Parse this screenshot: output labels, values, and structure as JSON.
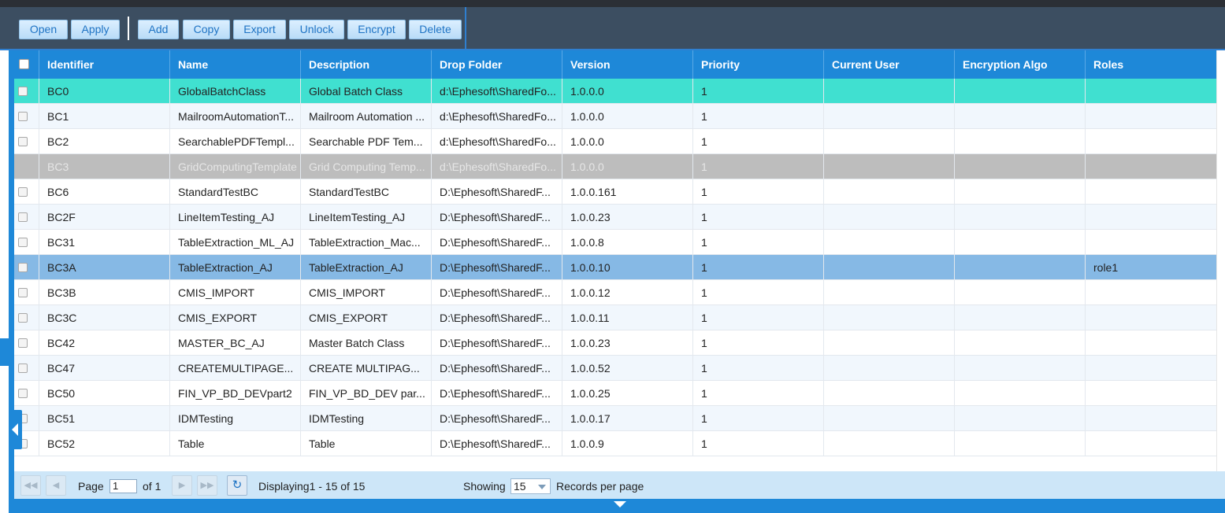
{
  "toolbar": {
    "buttons": [
      {
        "id": "open",
        "label": "Open"
      },
      {
        "id": "apply",
        "label": "Apply"
      },
      {
        "id": "add",
        "label": "Add"
      },
      {
        "id": "copy",
        "label": "Copy"
      },
      {
        "id": "export",
        "label": "Export"
      },
      {
        "id": "unlock",
        "label": "Unlock"
      },
      {
        "id": "encrypt",
        "label": "Encrypt"
      },
      {
        "id": "delete",
        "label": "Delete"
      }
    ]
  },
  "grid": {
    "columns": [
      "Identifier",
      "Name",
      "Description",
      "Drop Folder",
      "Version",
      "Priority",
      "Current User",
      "Encryption Algo",
      "Roles"
    ],
    "rows": [
      {
        "state": "selected-teal",
        "cells": [
          "BC0",
          "GlobalBatchClass",
          "Global Batch Class",
          "d:\\Ephesoft\\SharedFo...",
          "1.0.0.0",
          "1",
          "",
          "",
          ""
        ]
      },
      {
        "state": "alt",
        "cells": [
          "BC1",
          "MailroomAutomationT...",
          "Mailroom Automation ...",
          "d:\\Ephesoft\\SharedFo...",
          "1.0.0.0",
          "1",
          "",
          "",
          ""
        ]
      },
      {
        "state": "plain",
        "cells": [
          "BC2",
          "SearchablePDFTempl...",
          "Searchable PDF Tem...",
          "d:\\Ephesoft\\SharedFo...",
          "1.0.0.0",
          "1",
          "",
          "",
          ""
        ]
      },
      {
        "state": "disabled",
        "cells": [
          "BC3",
          "GridComputingTemplate",
          "Grid Computing Temp...",
          "d:\\Ephesoft\\SharedFo...",
          "1.0.0.0",
          "1",
          "",
          "",
          ""
        ]
      },
      {
        "state": "plain",
        "cells": [
          "BC6",
          "StandardTestBC",
          "StandardTestBC",
          "D:\\Ephesoft\\SharedF...",
          "1.0.0.161",
          "1",
          "",
          "",
          ""
        ]
      },
      {
        "state": "alt",
        "cells": [
          "BC2F",
          "LineItemTesting_AJ",
          "LineItemTesting_AJ",
          "D:\\Ephesoft\\SharedF...",
          "1.0.0.23",
          "1",
          "",
          "",
          ""
        ]
      },
      {
        "state": "plain",
        "cells": [
          "BC31",
          "TableExtraction_ML_AJ",
          "TableExtraction_Mac...",
          "D:\\Ephesoft\\SharedF...",
          "1.0.0.8",
          "1",
          "",
          "",
          ""
        ]
      },
      {
        "state": "selected-blue",
        "cells": [
          "BC3A",
          "TableExtraction_AJ",
          "TableExtraction_AJ",
          "D:\\Ephesoft\\SharedF...",
          "1.0.0.10",
          "1",
          "",
          "",
          "role1"
        ]
      },
      {
        "state": "plain",
        "cells": [
          "BC3B",
          "CMIS_IMPORT",
          "CMIS_IMPORT",
          "D:\\Ephesoft\\SharedF...",
          "1.0.0.12",
          "1",
          "",
          "",
          ""
        ]
      },
      {
        "state": "alt",
        "cells": [
          "BC3C",
          "CMIS_EXPORT",
          "CMIS_EXPORT",
          "D:\\Ephesoft\\SharedF...",
          "1.0.0.11",
          "1",
          "",
          "",
          ""
        ]
      },
      {
        "state": "plain",
        "cells": [
          "BC42",
          "MASTER_BC_AJ",
          "Master Batch Class",
          "D:\\Ephesoft\\SharedF...",
          "1.0.0.23",
          "1",
          "",
          "",
          ""
        ]
      },
      {
        "state": "alt",
        "cells": [
          "BC47",
          "CREATEMULTIPAGE...",
          "CREATE MULTIPAG...",
          "D:\\Ephesoft\\SharedF...",
          "1.0.0.52",
          "1",
          "",
          "",
          ""
        ]
      },
      {
        "state": "plain",
        "cells": [
          "BC50",
          "FIN_VP_BD_DEVpart2",
          "FIN_VP_BD_DEV par...",
          "D:\\Ephesoft\\SharedF...",
          "1.0.0.25",
          "1",
          "",
          "",
          ""
        ]
      },
      {
        "state": "alt",
        "cells": [
          "BC51",
          "IDMTesting",
          "IDMTesting",
          "D:\\Ephesoft\\SharedF...",
          "1.0.0.17",
          "1",
          "",
          "",
          ""
        ]
      },
      {
        "state": "plain",
        "cells": [
          "BC52",
          "Table",
          "Table",
          "D:\\Ephesoft\\SharedF...",
          "1.0.0.9",
          "1",
          "",
          "",
          ""
        ]
      }
    ]
  },
  "pager": {
    "page_label": "Page",
    "page_value": "1",
    "of_label": "of 1",
    "displaying": "Displaying1 - 15 of 15",
    "showing_label": "Showing",
    "page_size": "15",
    "records_label": "Records per page"
  },
  "colors": {
    "toolbar_bg": "#3c4e61",
    "header_bg": "#1e88d8",
    "selected_teal": "#40e0d0",
    "selected_blue": "#86b9e5",
    "disabled_row": "#bdbdbd",
    "pager_bg": "#cde6f8"
  },
  "icons": {
    "first_page": "first-page-icon",
    "prev_page": "prev-page-icon",
    "next_page": "next-page-icon",
    "last_page": "last-page-icon",
    "refresh": "refresh-icon",
    "collapse_left": "collapse-left-icon",
    "collapse_down": "collapse-down-icon"
  }
}
